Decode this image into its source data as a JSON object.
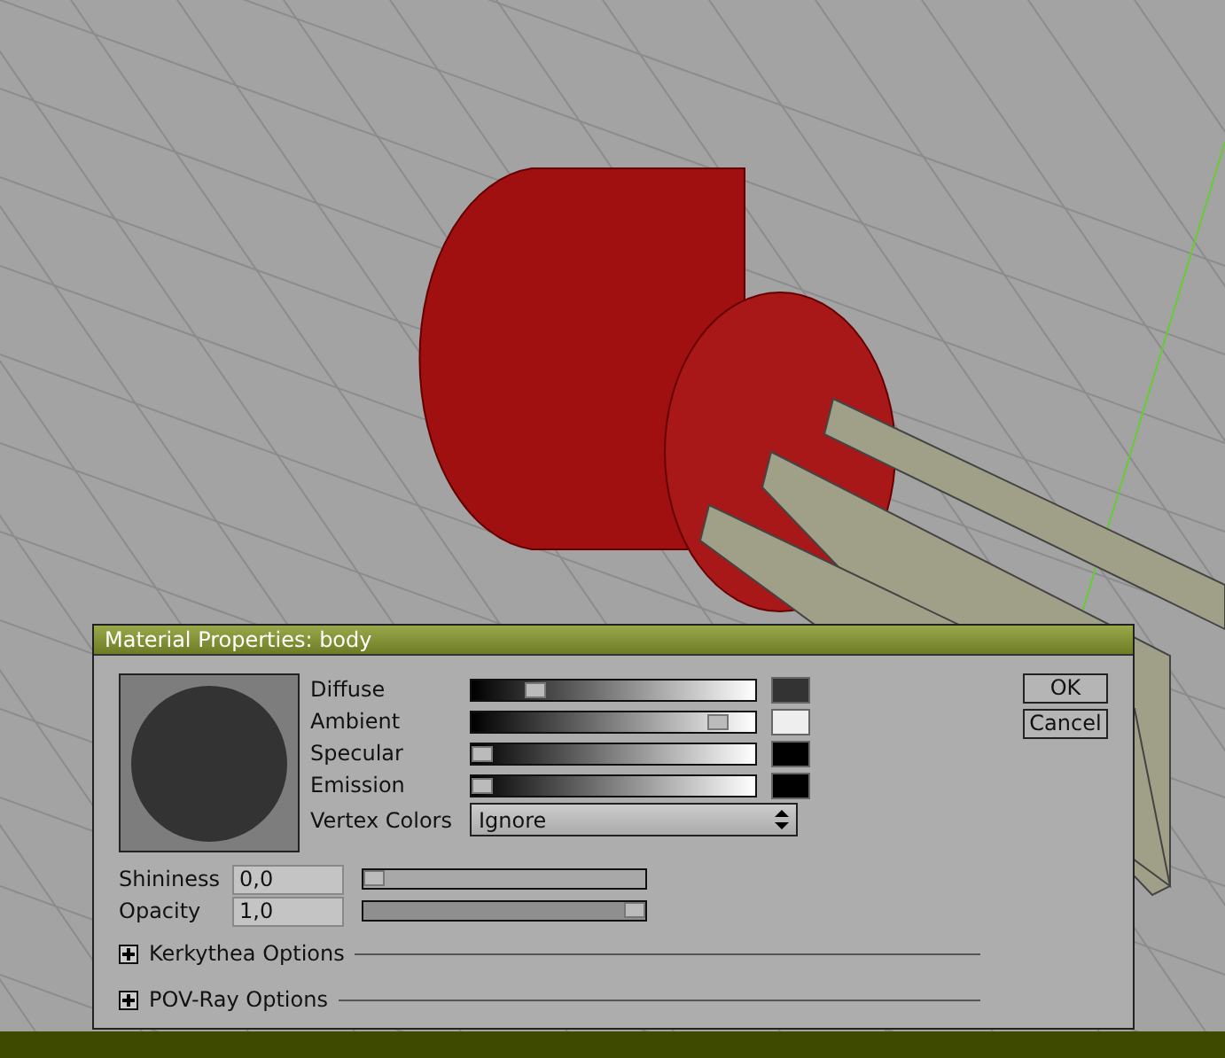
{
  "window": {
    "title": "Material Properties: body"
  },
  "colors": [
    {
      "label": "Diffuse",
      "level": 0.2,
      "color": "#333333"
    },
    {
      "label": "Ambient",
      "level": 0.9,
      "color": "#eeeeee"
    },
    {
      "label": "Specular",
      "level": 0.0,
      "color": "#000000"
    },
    {
      "label": "Emission",
      "level": 0.0,
      "color": "#000000"
    }
  ],
  "vertex_colors": {
    "label": "Vertex Colors",
    "value": "Ignore"
  },
  "buttons": [
    "OK",
    "Cancel"
  ],
  "properties": [
    {
      "label": "Shininess",
      "value": "0,0",
      "level": 0.0
    },
    {
      "label": "Opacity",
      "value": "1,0",
      "level": 1.0
    }
  ],
  "sections": [
    {
      "label": "Kerkythea Options",
      "expanded": false
    },
    {
      "label": "POV-Ray Options",
      "expanded": false
    }
  ]
}
